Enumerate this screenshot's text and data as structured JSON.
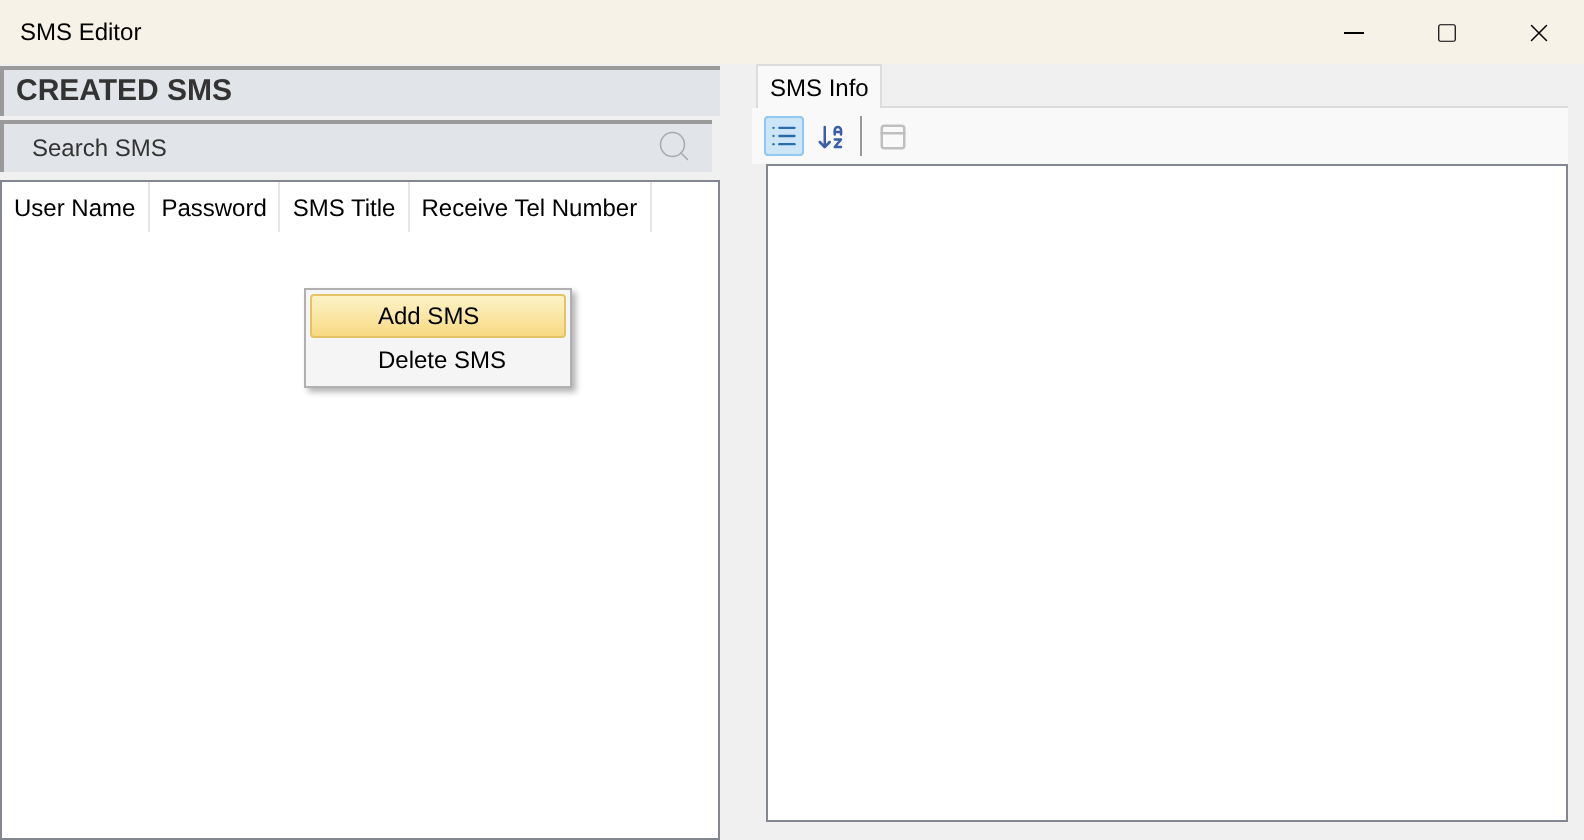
{
  "window": {
    "title": "SMS Editor"
  },
  "left_panel": {
    "header": "CREATED SMS",
    "search": {
      "placeholder": "Search SMS"
    },
    "table": {
      "columns": [
        "User Name",
        "Password",
        "SMS Title",
        "Receive Tel Number"
      ]
    }
  },
  "context_menu": [
    {
      "label": "Add SMS",
      "selected": true
    },
    {
      "label": "Delete SMS",
      "selected": false
    }
  ],
  "right_panel": {
    "tabs": [
      {
        "label": "SMS Info",
        "selected": true
      }
    ],
    "toolbar": [
      {
        "kind": "categorized",
        "selected": true,
        "disabled": false
      },
      {
        "kind": "alphabetical",
        "selected": false,
        "disabled": false
      },
      {
        "kind": "pages",
        "selected": false,
        "disabled": true
      }
    ]
  }
}
